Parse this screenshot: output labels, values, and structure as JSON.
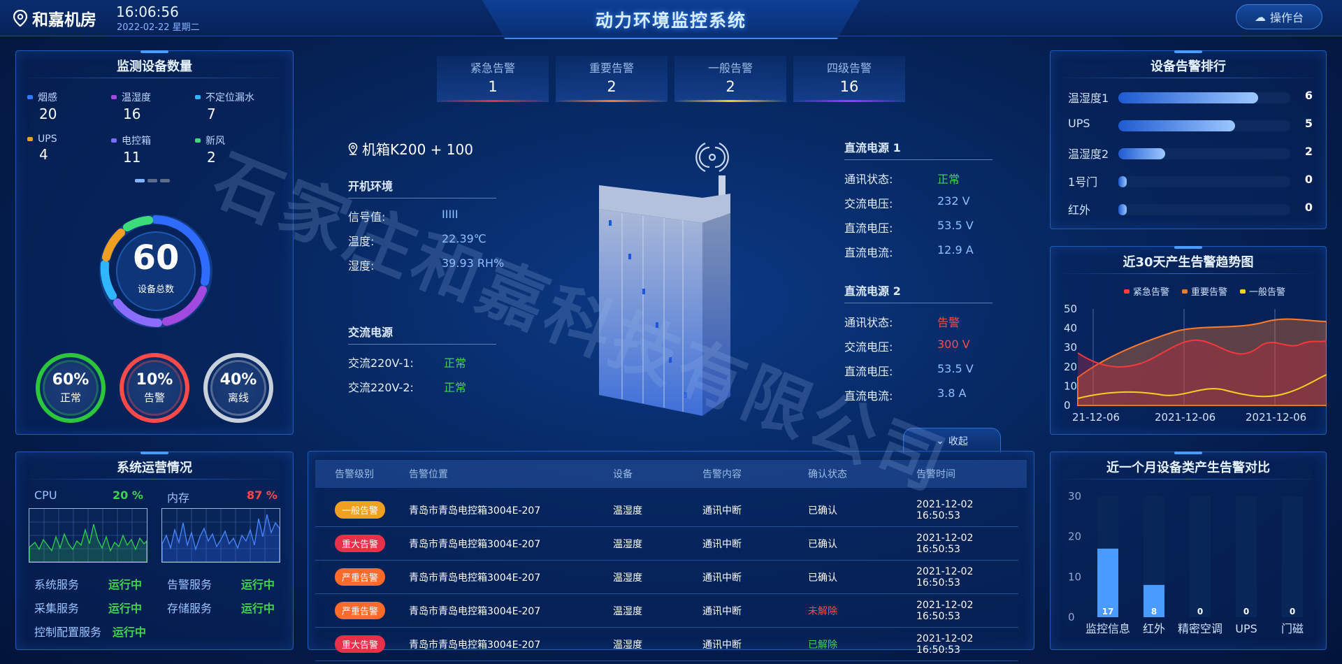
{
  "header": {
    "location": "和嘉机房",
    "time": "16:06:56",
    "date": "2022-02-22 星期二",
    "title": "动力环境监控系统",
    "ops_label": "操作台"
  },
  "device_count": {
    "title": "监测设备数量",
    "items": [
      {
        "label": "烟感",
        "value": "20",
        "color": "#2f7bff"
      },
      {
        "label": "温湿度",
        "value": "16",
        "color": "#a24ae0"
      },
      {
        "label": "不定位漏水",
        "value": "7",
        "color": "#2fb6ff"
      },
      {
        "label": "UPS",
        "value": "4",
        "color": "#f0a020"
      },
      {
        "label": "电控箱",
        "value": "11",
        "color": "#7a6bff"
      },
      {
        "label": "新风",
        "value": "2",
        "color": "#3ddc7a"
      }
    ],
    "total": "60",
    "total_label": "设备总数",
    "status": [
      {
        "pct": "60%",
        "label": "正常",
        "color": "#2bc63c"
      },
      {
        "pct": "10%",
        "label": "告警",
        "color": "#ff4a4a"
      },
      {
        "pct": "40%",
        "label": "离线",
        "color": "#c8d0dc"
      }
    ]
  },
  "alarms": [
    {
      "name": "紧急告警",
      "count": "1",
      "color": "#e8304a"
    },
    {
      "name": "重要告警",
      "count": "2",
      "color": "#ff7a2a"
    },
    {
      "name": "一般告警",
      "count": "2",
      "color": "#f5d020"
    },
    {
      "name": "四级告警",
      "count": "16",
      "color": "#9a3cff"
    }
  ],
  "cabinet": {
    "name": "机箱K200 + 100",
    "env_title": "开机环境",
    "signal_label": "信号值:",
    "signal_value": "IIIII",
    "temp_label": "温度:",
    "temp_value": "22.39℃",
    "humidity_label": "湿度:",
    "humidity_value": "39.93 RH%",
    "ac_title": "交流电源",
    "ac1_label": "交流220V-1:",
    "ac1_value": "正常",
    "ac2_label": "交流220V-2:",
    "ac2_value": "正常"
  },
  "dc1": {
    "title": "直流电源 1",
    "rows": [
      {
        "label": "通讯状态:",
        "value": "正常",
        "color": "#3fd44c"
      },
      {
        "label": "交流电压:",
        "value": "232 V",
        "color": "#8ec0ff"
      },
      {
        "label": "直流电压:",
        "value": "53.5 V",
        "color": "#8ec0ff"
      },
      {
        "label": "直流电流:",
        "value": "12.9 A",
        "color": "#8ec0ff"
      }
    ]
  },
  "dc2": {
    "title": "直流电源 2",
    "rows": [
      {
        "label": "通讯状态:",
        "value": "告警",
        "color": "#ff4a4a"
      },
      {
        "label": "交流电压:",
        "value": "300 V",
        "color": "#ff4a4a"
      },
      {
        "label": "直流电压:",
        "value": "53.5 V",
        "color": "#8ec0ff"
      },
      {
        "label": "直流电流:",
        "value": "3.8 A",
        "color": "#8ec0ff"
      }
    ]
  },
  "ranking": {
    "title": "设备告警排行",
    "max": 6,
    "items": [
      {
        "name": "温湿度1",
        "value": 6
      },
      {
        "name": "UPS",
        "value": 5
      },
      {
        "name": "温湿度2",
        "value": 2
      },
      {
        "name": "1号门",
        "value": 0
      },
      {
        "name": "红外",
        "value": 0
      }
    ]
  },
  "trend": {
    "title": "近30天产生告警趋势图",
    "legend": [
      {
        "name": "紧急告警",
        "color": "#ff3b3b"
      },
      {
        "name": "重要告警",
        "color": "#ff7a2a"
      },
      {
        "name": "一般告警",
        "color": "#f5d020"
      }
    ],
    "yticks": [
      "50",
      "40",
      "30",
      "20",
      "10",
      "0"
    ],
    "xticks": [
      "21-12-06",
      "2021-12-06",
      "2021-12-06"
    ]
  },
  "system": {
    "title": "系统运营情况",
    "cpu_label": "CPU",
    "cpu_value": "20 %",
    "mem_label": "内存",
    "mem_value": "87 %",
    "services": [
      {
        "label": "系统服务",
        "value": "运行中"
      },
      {
        "label": "告警服务",
        "value": "运行中"
      },
      {
        "label": "采集服务",
        "value": "运行中"
      },
      {
        "label": "存储服务",
        "value": "运行中"
      },
      {
        "label": "控制配置服务",
        "value": "运行中"
      }
    ]
  },
  "table": {
    "collapse_label": "收起",
    "headers": [
      "告警级别",
      "告警位置",
      "设备",
      "告警内容",
      "确认状态",
      "告警时间"
    ],
    "rows": [
      {
        "level": "一般告警",
        "level_color": "#f0a020",
        "location": "青岛市青岛电控箱3004E-207",
        "device": "温湿度",
        "content": "通讯中断",
        "status": "已确认",
        "status_color": "#ffffff",
        "time": "2021-12-02  16:50:53"
      },
      {
        "level": "重大告警",
        "level_color": "#e8304a",
        "location": "青岛市青岛电控箱3004E-207",
        "device": "温湿度",
        "content": "通讯中断",
        "status": "已确认",
        "status_color": "#ffffff",
        "time": "2021-12-02  16:50:53"
      },
      {
        "level": "严重告警",
        "level_color": "#ff6a2a",
        "location": "青岛市青岛电控箱3004E-207",
        "device": "温湿度",
        "content": "通讯中断",
        "status": "已确认",
        "status_color": "#ffffff",
        "time": "2021-12-02  16:50:53"
      },
      {
        "level": "严重告警",
        "level_color": "#ff6a2a",
        "location": "青岛市青岛电控箱3004E-207",
        "device": "温湿度",
        "content": "通讯中断",
        "status": "未解除",
        "status_color": "#ff4a4a",
        "time": "2021-12-02  16:50:53"
      },
      {
        "level": "重大告警",
        "level_color": "#e8304a",
        "location": "青岛市青岛电控箱3004E-207",
        "device": "温湿度",
        "content": "通讯中断",
        "status": "已解除",
        "status_color": "#3fd44c",
        "time": "2021-12-02  16:50:53"
      }
    ]
  },
  "compare": {
    "title": "近一个月设备类产生告警对比"
  },
  "chart_data": {
    "type": "bar",
    "title": "近一个月设备类产生告警对比",
    "categories": [
      "监控信息",
      "红外",
      "精密空调",
      "UPS",
      "门磁"
    ],
    "values": [
      17,
      8,
      0,
      0,
      0
    ],
    "yticks": [
      "30",
      "20",
      "10",
      "0"
    ],
    "ylim": [
      0,
      30
    ]
  },
  "watermark": "石家庄和嘉科技有限公司"
}
